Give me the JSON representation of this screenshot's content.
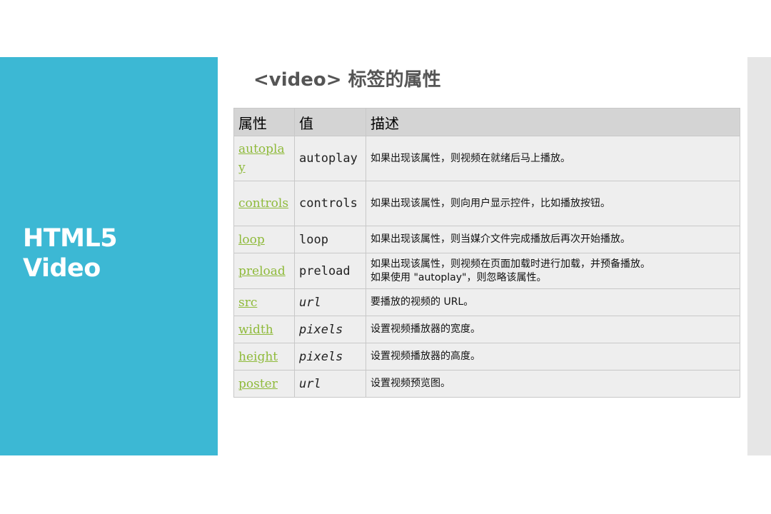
{
  "sidebar": {
    "title_line1": "HTML5",
    "title_line2": "Video"
  },
  "heading": "<video> 标签的属性",
  "table": {
    "headers": {
      "attr": "属性",
      "value": "值",
      "desc": "描述"
    },
    "rows": [
      {
        "attr": "autoplay",
        "value": "autoplay",
        "desc": "如果出现该属性，则视频在就绪后马上播放。"
      },
      {
        "attr": "controls",
        "value": "controls",
        "desc": "如果出现该属性，则向用户显示控件，比如播放按钮。"
      },
      {
        "attr": "loop",
        "value": "loop",
        "desc": "如果出现该属性，则当媒介文件完成播放后再次开始播放。"
      },
      {
        "attr": "preload",
        "value": "preload",
        "desc": "如果出现该属性，则视频在页面加载时进行加载，并预备播放。",
        "desc2": "如果使用 \"autoplay\"，则忽略该属性。"
      },
      {
        "attr": "src",
        "value": "url",
        "desc": "要播放的视频的 URL。"
      },
      {
        "attr": "width",
        "value": "pixels",
        "desc": "设置视频播放器的宽度。"
      },
      {
        "attr": "height",
        "value": "pixels",
        "desc": "设置视频播放器的高度。"
      },
      {
        "attr": "poster",
        "value": "url",
        "desc": "设置视频预览图。"
      }
    ]
  },
  "colors": {
    "panel": "#3cb8d4",
    "link": "#8fba3b",
    "header_bg": "#d4d4d4",
    "row_bg": "#eeeeee",
    "strip": "#e6e6e6"
  }
}
